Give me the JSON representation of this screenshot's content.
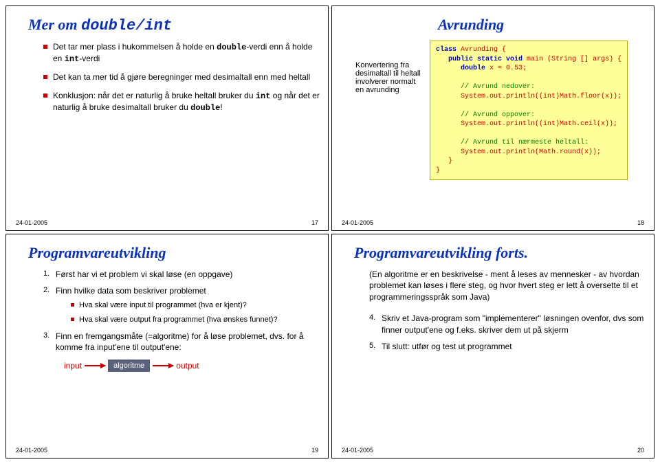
{
  "date": "24-01-2005",
  "slide1": {
    "title_pre": "Mer om ",
    "title_code": "double/int",
    "b1_pre": "Det tar mer plass i hukommelsen å holde en ",
    "b1_c1": "double",
    "b1_mid": "-verdi enn å holde en ",
    "b1_c2": "int",
    "b1_post": "-verdi",
    "b2": "Det kan ta mer tid å gjøre beregninger med desimaltall enn med heltall",
    "b3_pre": "Konklusjon: når det er naturlig å bruke heltall bruker du ",
    "b3_c1": "int",
    "b3_mid": " og når det er naturlig å bruke desimaltall bruker du ",
    "b3_c2": "double",
    "b3_post": "!",
    "page": "17"
  },
  "slide2": {
    "title": "Avrunding",
    "note": "Konvertering fra desimaltall til heltall involverer normalt en avrunding",
    "code": {
      "l1a": "class ",
      "l1b": "Avrunding {",
      "l2a": "public static void ",
      "l2b": "main (String [] args) {",
      "l3a": "double ",
      "l3b": "x = 0.53;",
      "c1": "// Avrund nedover:",
      "l4": "System.out.println((int)Math.floor(x));",
      "c2": "// Avrund oppover:",
      "l5": "System.out.println((int)Math.ceil(x));",
      "c3": "// Avrund til nærmeste heltall:",
      "l6": "System.out.println(Math.round(x));",
      "close1": "}",
      "close2": "}"
    },
    "page": "18"
  },
  "slide3": {
    "title": "Programvareutvikling",
    "n1": "Først har vi et problem vi skal løse (en oppgave)",
    "n2": "Finn hvilke data som beskriver problemet",
    "n2a": "Hva skal være input til programmet (hva er kjent)?",
    "n2b": "Hva skal være output fra programmet (hva ønskes funnet)?",
    "n3": "Finn en fremgangsmåte (=algoritme) for å løse problemet, dvs. for å komme fra input'ene til output'ene:",
    "flow_in": "input",
    "flow_algo": "algoritme",
    "flow_out": "output",
    "page": "19"
  },
  "slide4": {
    "title": "Programvareutvikling forts.",
    "para": "(En algoritme er en beskrivelse - ment å leses av mennesker - av hvordan problemet kan løses i flere steg, og hvor hvert steg er lett å oversette til et programmeringsspråk som Java)",
    "n4num": "4.",
    "n4": "Skriv et Java-program som \"implementerer\" løsningen ovenfor, dvs som finner output'ene og f.eks. skriver dem ut på skjerm",
    "n5num": "5.",
    "n5": "Til slutt: utfør og test ut programmet",
    "page": "20"
  }
}
